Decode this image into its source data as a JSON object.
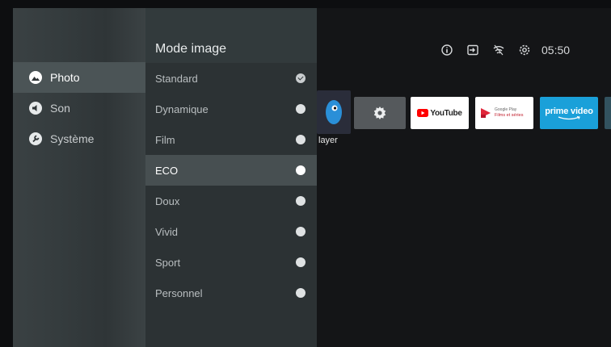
{
  "left_menu": [
    {
      "label": "Photo",
      "icon": "photo-icon",
      "active": true
    },
    {
      "label": "Son",
      "icon": "speaker-icon",
      "active": false
    },
    {
      "label": "Système",
      "icon": "wrench-icon",
      "active": false
    }
  ],
  "picture_mode": {
    "title": "Mode image",
    "options": [
      {
        "label": "Standard",
        "state": "checked"
      },
      {
        "label": "Dynamique",
        "state": "unchecked"
      },
      {
        "label": "Film",
        "state": "unchecked"
      },
      {
        "label": "ECO",
        "state": "focused"
      },
      {
        "label": "Doux",
        "state": "unchecked"
      },
      {
        "label": "Vivid",
        "state": "unchecked"
      },
      {
        "label": "Sport",
        "state": "unchecked"
      },
      {
        "label": "Personnel",
        "state": "unchecked"
      }
    ]
  },
  "status_bar": {
    "time": "05:50",
    "icons": [
      "info-icon",
      "input-icon",
      "wifi-icon",
      "settings-icon"
    ]
  },
  "apps": {
    "partial_label": "layer",
    "youtube": "YouTube",
    "google_play_top": "Google Play",
    "google_play_bottom": "Films et séries",
    "prime": "prime video"
  },
  "colors": {
    "accent_youtube": "#ff0000",
    "prime_bg": "#1aa0d9",
    "play_red": "#e0263a"
  }
}
